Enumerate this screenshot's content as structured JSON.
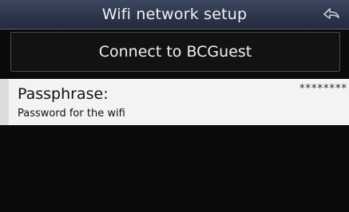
{
  "header": {
    "title": "Wifi network setup",
    "back_icon": "back-arrow-icon"
  },
  "connect": {
    "label": "Connect to BCGuest"
  },
  "passphrase": {
    "label": "Passphrase:",
    "value": "********",
    "description": "Password for the wifi"
  },
  "colors": {
    "title_bar": "#2c364c",
    "background": "#0a0a0a",
    "selected_row": "#f3f3f3"
  }
}
